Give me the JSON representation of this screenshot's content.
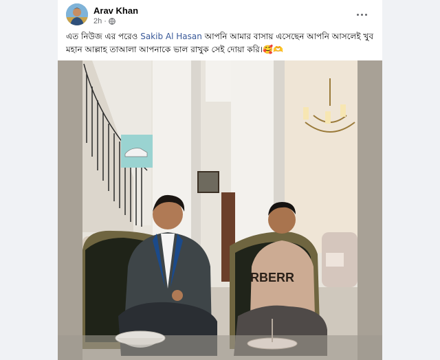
{
  "post": {
    "author": "Arav Khan",
    "time": "2h",
    "separator": "·",
    "privacy_icon": "globe-icon",
    "more_icon": "more-options-icon",
    "text_before": "এত নিউজ এর পরেও ",
    "mention": "Sakib Al Hasan",
    "text_after": " আপনি আমার বাসায় এসেছেন আপনি আসলেই খুব মহান আল্লাহ তাআলা আপনাকে ভাল রাখুক সেই দোয়া করি।🥰🫶",
    "photo_shirt_text": "RBERR"
  },
  "colors": {
    "mention": "#385898",
    "background": "#f0f2f5"
  }
}
